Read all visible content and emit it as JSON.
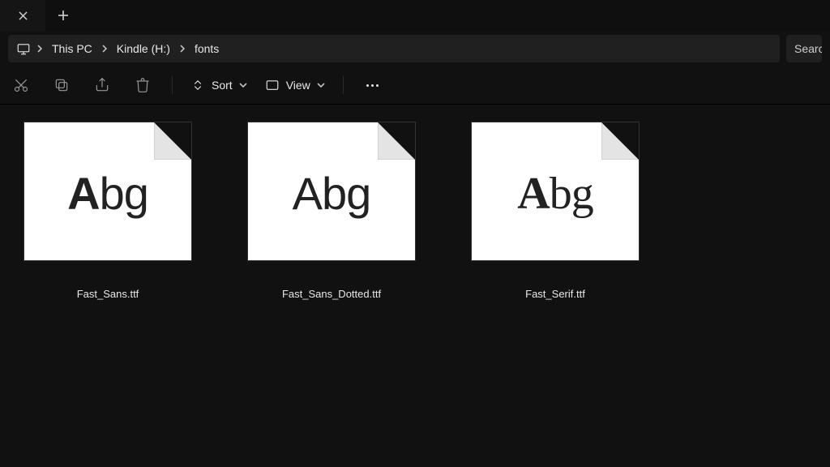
{
  "breadcrumb": {
    "root": "This PC",
    "drive": "Kindle (H:)",
    "folder": "fonts"
  },
  "search": {
    "placeholder": "Search"
  },
  "toolbar": {
    "sort_label": "Sort",
    "view_label": "View"
  },
  "files": [
    {
      "name": "Fast_Sans.ttf",
      "preview": "Abg",
      "style": "sans"
    },
    {
      "name": "Fast_Sans_Dotted.ttf",
      "preview": "Abg",
      "style": "sans2"
    },
    {
      "name": "Fast_Serif.ttf",
      "preview": "Abg",
      "style": "serif"
    }
  ]
}
